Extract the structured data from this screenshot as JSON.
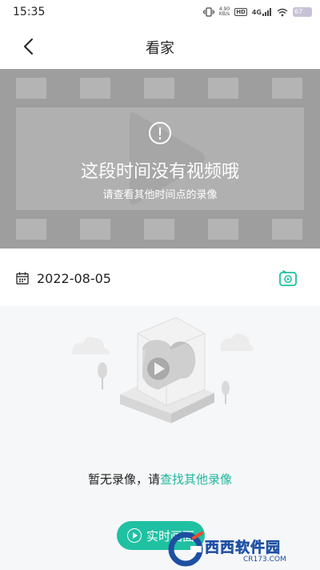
{
  "status_bar": {
    "time": "15:35",
    "network_speed_value": "4.90",
    "network_speed_unit": "KB/s",
    "hd_label": "HD",
    "network_type": "4G",
    "battery_level": "67"
  },
  "nav": {
    "title": "看家"
  },
  "video": {
    "message": "这段时间没有视频哦",
    "sub_message": "请查看其他时间点的录像"
  },
  "date_bar": {
    "date": "2022-08-05"
  },
  "empty": {
    "text": "暂无录像，请",
    "link": "查找其他录像"
  },
  "live_button": {
    "label": "实时画面"
  },
  "watermark": {
    "text": "西西软件园",
    "url": "CR173.COM"
  },
  "colors": {
    "accent": "#20c0a2",
    "link": "#1fb6a0",
    "video_bg": "#9e9e9e"
  }
}
